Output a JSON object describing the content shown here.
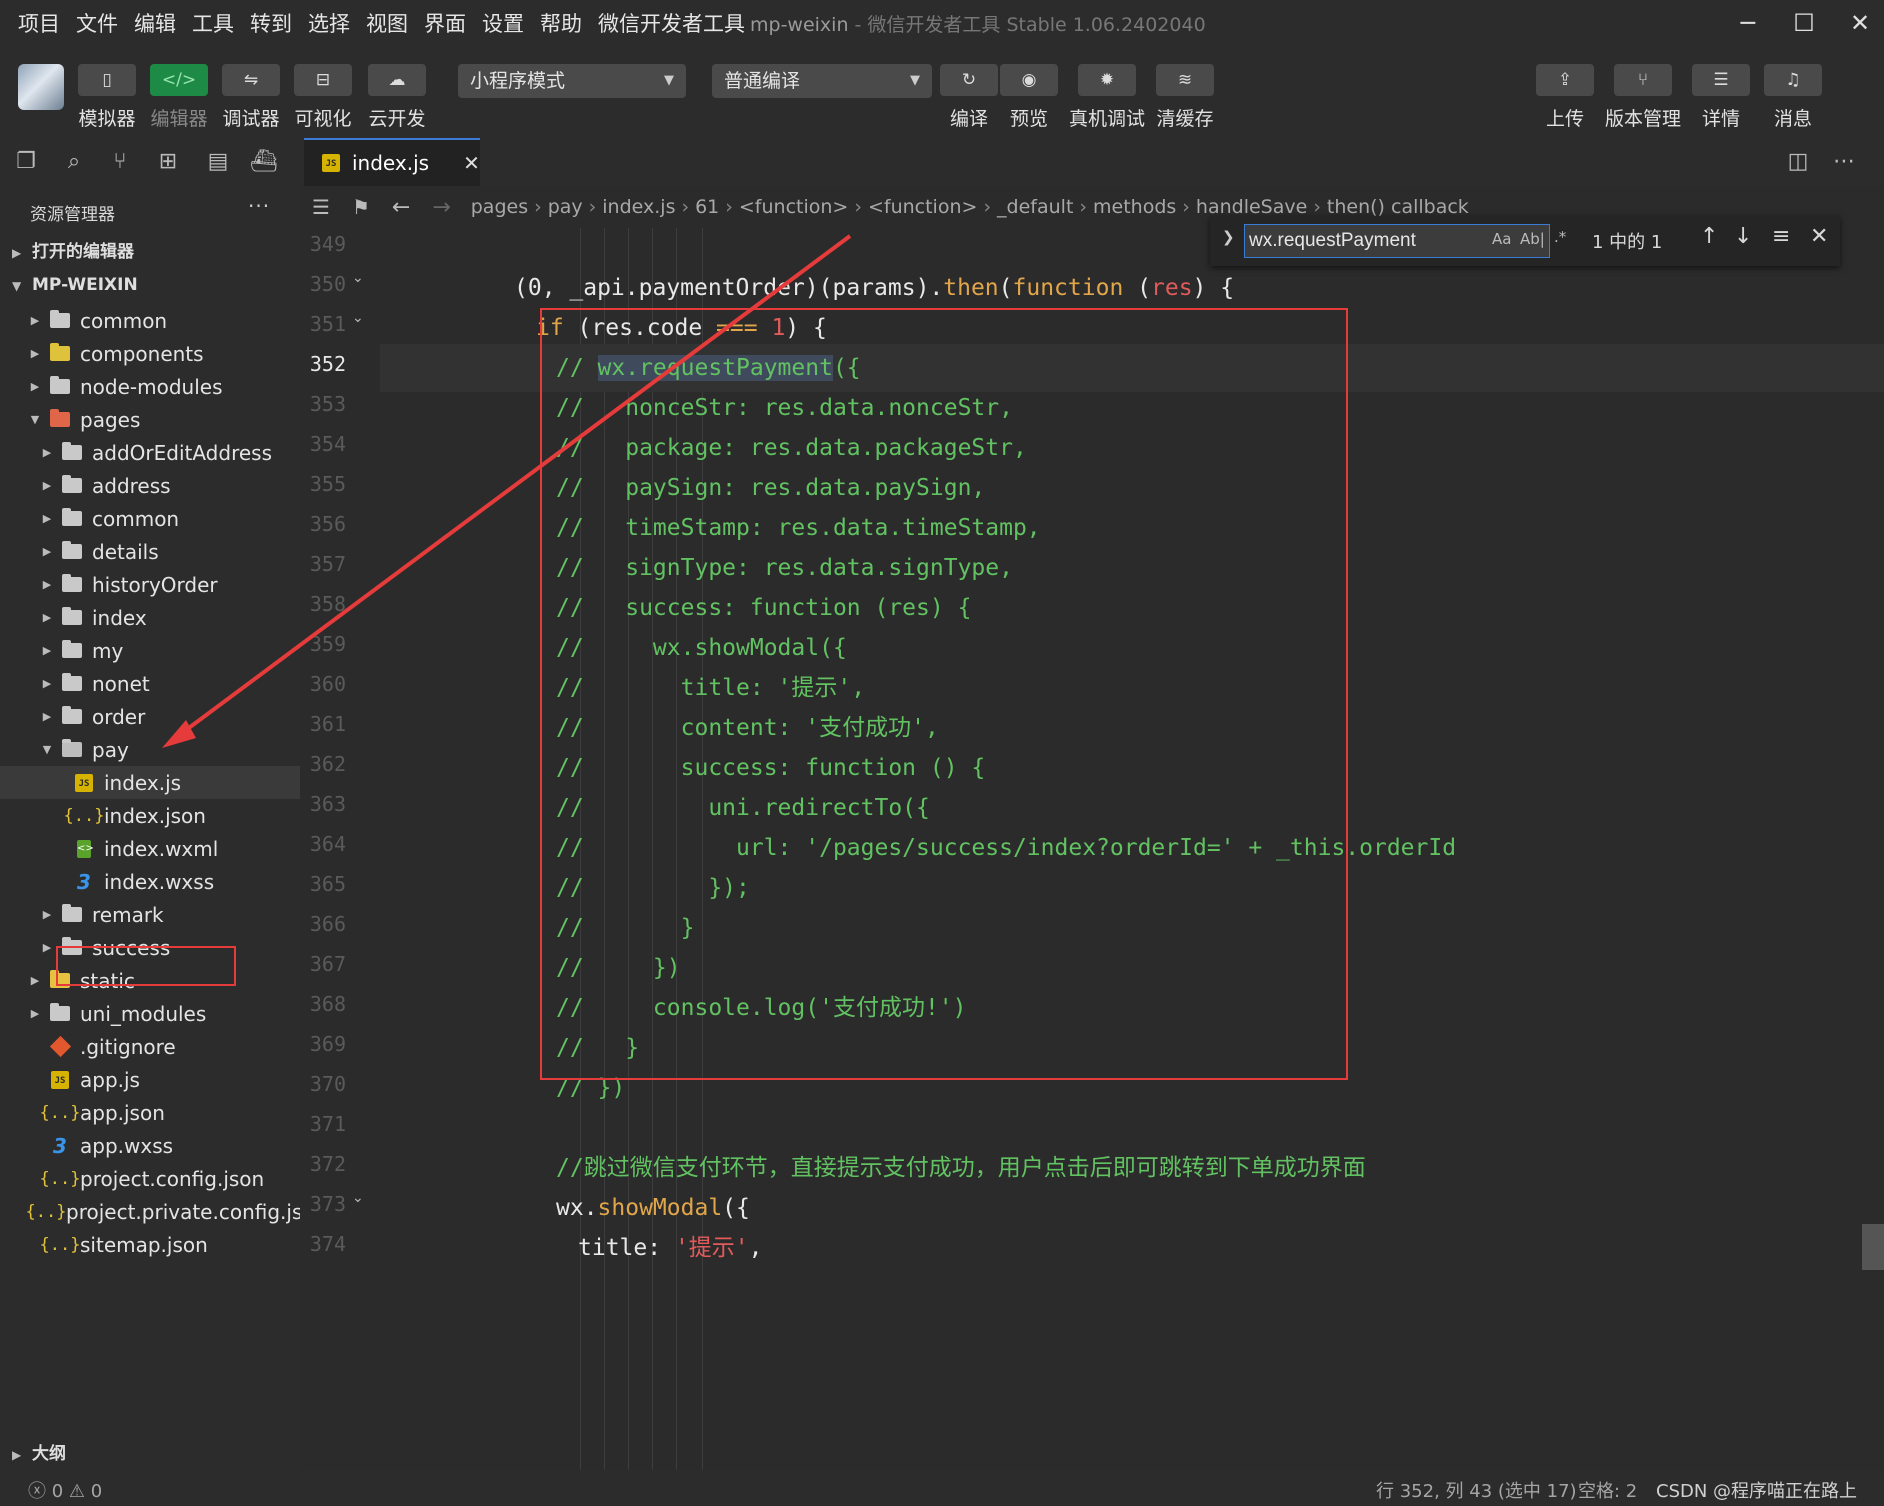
{
  "menubar": {
    "items": [
      "项目",
      "文件",
      "编辑",
      "工具",
      "转到",
      "选择",
      "视图",
      "界面",
      "设置",
      "帮助",
      "微信开发者工具"
    ],
    "title": "mp-weixin",
    "subtitle": " - 微信开发者工具 Stable 1.06.2402040"
  },
  "toolbar": {
    "left_buttons": [
      {
        "label": "模拟器",
        "icon": "phone-icon"
      },
      {
        "label": "编辑器",
        "icon": "code-icon"
      },
      {
        "label": "调试器",
        "icon": "debug-icon"
      },
      {
        "label": "可视化",
        "icon": "layout-icon"
      },
      {
        "label": "云开发",
        "icon": "cloud-icon"
      }
    ],
    "mode_select": "小程序模式",
    "compile_select": "普通编译",
    "mid_buttons": [
      {
        "label": "编译",
        "icon": "refresh-icon"
      },
      {
        "label": "预览",
        "icon": "eye-icon"
      },
      {
        "label": "真机调试",
        "icon": "bug-icon"
      },
      {
        "label": "清缓存",
        "icon": "layers-icon"
      }
    ],
    "right_buttons": [
      {
        "label": "上传",
        "icon": "upload-icon"
      },
      {
        "label": "版本管理",
        "icon": "branch-icon"
      },
      {
        "label": "详情",
        "icon": "menu-icon"
      },
      {
        "label": "消息",
        "icon": "bell-icon"
      }
    ]
  },
  "tab": {
    "name": "index.js",
    "badge": "JS"
  },
  "sidebar": {
    "title": "资源管理器",
    "more": "···",
    "open_editors": "打开的编辑器",
    "project": "MP-WEIXIN",
    "outline": "大纲",
    "tree": [
      {
        "name": "common",
        "depth": 1,
        "type": "folder"
      },
      {
        "name": "components",
        "depth": 1,
        "type": "folder-comp"
      },
      {
        "name": "node-modules",
        "depth": 1,
        "type": "folder"
      },
      {
        "name": "pages",
        "depth": 1,
        "type": "folder-pages",
        "open": true
      },
      {
        "name": "addOrEditAddress",
        "depth": 2,
        "type": "folder"
      },
      {
        "name": "address",
        "depth": 2,
        "type": "folder"
      },
      {
        "name": "common",
        "depth": 2,
        "type": "folder"
      },
      {
        "name": "details",
        "depth": 2,
        "type": "folder"
      },
      {
        "name": "historyOrder",
        "depth": 2,
        "type": "folder"
      },
      {
        "name": "index",
        "depth": 2,
        "type": "folder"
      },
      {
        "name": "my",
        "depth": 2,
        "type": "folder"
      },
      {
        "name": "nonet",
        "depth": 2,
        "type": "folder"
      },
      {
        "name": "order",
        "depth": 2,
        "type": "folder"
      },
      {
        "name": "pay",
        "depth": 2,
        "type": "folder",
        "open": true
      },
      {
        "name": "index.js",
        "depth": 3,
        "type": "js",
        "selected": true
      },
      {
        "name": "index.json",
        "depth": 3,
        "type": "json"
      },
      {
        "name": "index.wxml",
        "depth": 3,
        "type": "wxml"
      },
      {
        "name": "index.wxss",
        "depth": 3,
        "type": "wxss"
      },
      {
        "name": "remark",
        "depth": 2,
        "type": "folder"
      },
      {
        "name": "success",
        "depth": 2,
        "type": "folder"
      },
      {
        "name": "static",
        "depth": 1,
        "type": "folder-static"
      },
      {
        "name": "uni_modules",
        "depth": 1,
        "type": "folder"
      },
      {
        "name": ".gitignore",
        "depth": 1,
        "type": "git"
      },
      {
        "name": "app.js",
        "depth": 1,
        "type": "js"
      },
      {
        "name": "app.json",
        "depth": 1,
        "type": "json"
      },
      {
        "name": "app.wxss",
        "depth": 1,
        "type": "wxss"
      },
      {
        "name": "project.config.json",
        "depth": 1,
        "type": "json"
      },
      {
        "name": "project.private.config.js...",
        "depth": 1,
        "type": "json"
      },
      {
        "name": "sitemap.json",
        "depth": 1,
        "type": "json"
      }
    ]
  },
  "breadcrumb": [
    "pages",
    "pay",
    "index.js",
    "61",
    "<function>",
    "<function>",
    "_default",
    "methods",
    "handleSave",
    "then() callback"
  ],
  "find": {
    "query": "wx.requestPayment",
    "case": "Aa",
    "word": "Ab|",
    "regex": ".*",
    "count": "1 中的 1"
  },
  "editor": {
    "line_numbers": [
      "349",
      "350",
      "351",
      "352",
      "353",
      "354",
      "355",
      "356",
      "357",
      "358",
      "359",
      "360",
      "361",
      "362",
      "363",
      "364",
      "365",
      "366",
      "367",
      "368",
      "369",
      "370",
      "371",
      "372",
      "373",
      "374"
    ],
    "current_line": "352",
    "code": [
      [],
      [
        [
          "p",
          "(0, _api.paymentOrder)(params)."
        ],
        [
          "fn",
          "then"
        ],
        [
          "p",
          "("
        ],
        [
          "kw",
          "function"
        ],
        [
          "p",
          " ("
        ],
        [
          "num",
          "res"
        ],
        [
          "p",
          ") {"
        ]
      ],
      [
        [
          "kw",
          "if"
        ],
        [
          "p",
          " (res.code "
        ],
        [
          "kw",
          "==="
        ],
        [
          "p",
          " "
        ],
        [
          "num",
          "1"
        ],
        [
          "p",
          ") {"
        ]
      ],
      [
        [
          "cm",
          "// "
        ],
        [
          "cmhl",
          "wx.requestPayment"
        ],
        [
          "cm",
          "({"
        ]
      ],
      [
        [
          "cm",
          "//   nonceStr: res.data.nonceStr,"
        ]
      ],
      [
        [
          "cm",
          "//   package: res.data.packageStr,"
        ]
      ],
      [
        [
          "cm",
          "//   paySign: res.data.paySign,"
        ]
      ],
      [
        [
          "cm",
          "//   timeStamp: res.data.timeStamp,"
        ]
      ],
      [
        [
          "cm",
          "//   signType: res.data.signType,"
        ]
      ],
      [
        [
          "cm",
          "//   success: function (res) {"
        ]
      ],
      [
        [
          "cm",
          "//     wx.showModal({"
        ]
      ],
      [
        [
          "cm",
          "//       title: '提示',"
        ]
      ],
      [
        [
          "cm",
          "//       content: '支付成功',"
        ]
      ],
      [
        [
          "cm",
          "//       success: function () {"
        ]
      ],
      [
        [
          "cm",
          "//         uni.redirectTo({"
        ]
      ],
      [
        [
          "cm",
          "//           url: '/pages/success/index?orderId=' + _this.orderId"
        ]
      ],
      [
        [
          "cm",
          "//         });"
        ]
      ],
      [
        [
          "cm",
          "//       }"
        ]
      ],
      [
        [
          "cm",
          "//     })"
        ]
      ],
      [
        [
          "cm",
          "//     console.log('支付成功!')"
        ]
      ],
      [
        [
          "cm",
          "//   }"
        ]
      ],
      [
        [
          "cm",
          "// })"
        ]
      ],
      [],
      [
        [
          "cm",
          "//跳过微信支付环节，直接提示支付成功，用户点击后即可跳转到下单成功界面"
        ]
      ],
      [
        [
          "p",
          "wx."
        ],
        [
          "fn",
          "showModal"
        ],
        [
          "p",
          "({"
        ]
      ],
      [
        [
          "p",
          "title: "
        ],
        [
          "str",
          "'提示'"
        ],
        [
          "p",
          ","
        ]
      ]
    ]
  },
  "status": {
    "problems": "ⓧ 0 ⚠ 0",
    "position": "行 352, 列 43 (选中 17)",
    "indent": "空格: 2",
    "watermark": "CSDN @程序喵正在路上"
  }
}
